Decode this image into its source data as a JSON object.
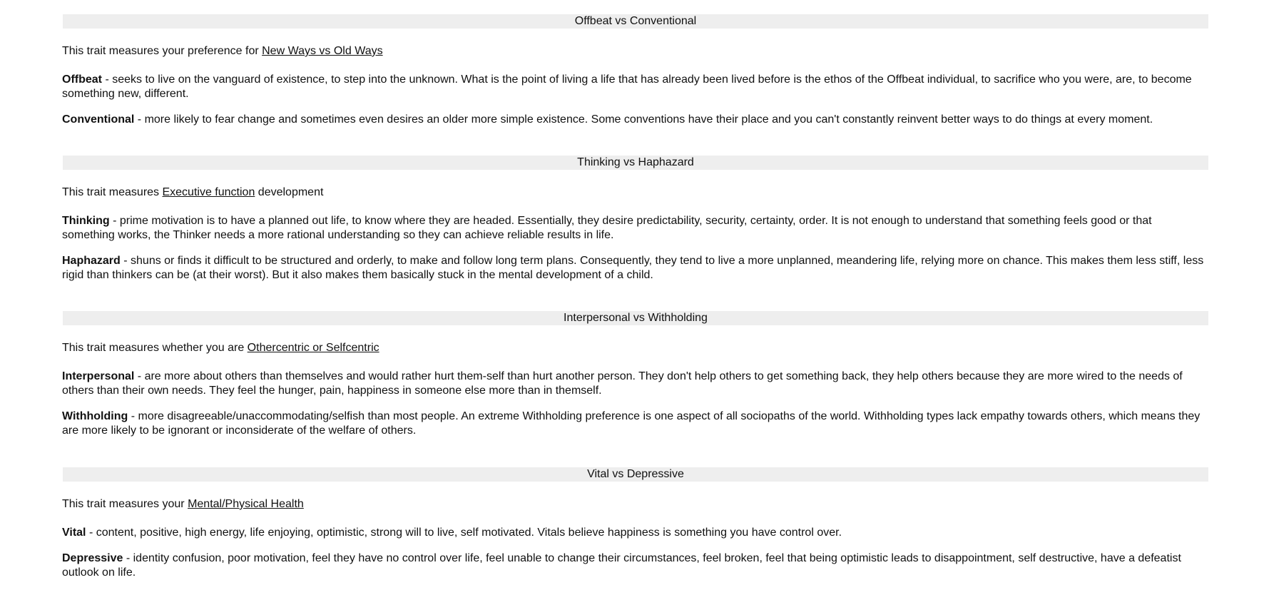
{
  "sections": [
    {
      "title": "Offbeat vs Conventional",
      "intro_prefix": "This trait measures your preference for ",
      "intro_link": "New Ways vs Old Ways",
      "intro_suffix": "",
      "traits": [
        {
          "name": "Offbeat",
          "description": " - seeks to live on the vanguard of existence, to step into the unknown. What is the point of living a life that has already been lived before is the ethos of the Offbeat individual, to sacrifice who you were, are, to become something new, different."
        },
        {
          "name": "Conventional",
          "description": " - more likely to fear change and sometimes even desires an older more simple existence. Some conventions have their place and you can't constantly reinvent better ways to do things at every moment."
        }
      ]
    },
    {
      "title": "Thinking vs Haphazard",
      "intro_prefix": "This trait measures ",
      "intro_link": "Executive function",
      "intro_suffix": " development",
      "traits": [
        {
          "name": "Thinking",
          "description": " - prime motivation is to have a planned out life, to know where they are headed. Essentially, they desire predictability, security, certainty, order. It is not enough to understand that something feels good or that something works, the Thinker needs a more rational understanding so they can achieve reliable results in life."
        },
        {
          "name": "Haphazard",
          "description": " - shuns or finds it difficult to be structured and orderly, to make and follow long term plans. Consequently, they tend to live a more unplanned, meandering life, relying more on chance. This makes them less stiff, less rigid than thinkers can be (at their worst). But it also makes them basically stuck in the mental development of a child."
        }
      ]
    },
    {
      "title": "Interpersonal vs Withholding",
      "intro_prefix": "This trait measures whether you are ",
      "intro_link": "Othercentric or Selfcentric",
      "intro_suffix": "",
      "traits": [
        {
          "name": "Interpersonal",
          "description": " - are more about others than themselves and would rather hurt them-self than hurt another person. They don't help others to get something back, they help others because they are more wired to the needs of others than their own needs. They feel the hunger, pain, happiness in someone else more than in themself."
        },
        {
          "name": "Withholding",
          "description": " - more disagreeable/unaccommodating/selfish than most people. An extreme Withholding preference is one aspect of all sociopaths of the world. Withholding types lack empathy towards others, which means they are more likely to be ignorant or inconsiderate of the welfare of others."
        }
      ]
    },
    {
      "title": "Vital vs Depressive",
      "intro_prefix": "This trait measures your ",
      "intro_link": "Mental/Physical Health",
      "intro_suffix": "",
      "traits": [
        {
          "name": "Vital",
          "description": " - content, positive, high energy, life enjoying, optimistic, strong will to live, self motivated. Vitals believe happiness is something you have control over."
        },
        {
          "name": "Depressive",
          "description": " - identity confusion, poor motivation, feel they have no control over life, feel unable to change their circumstances, feel broken, feel that being optimistic leads to disappointment, self destructive, have a defeatist outlook on life."
        }
      ]
    }
  ]
}
